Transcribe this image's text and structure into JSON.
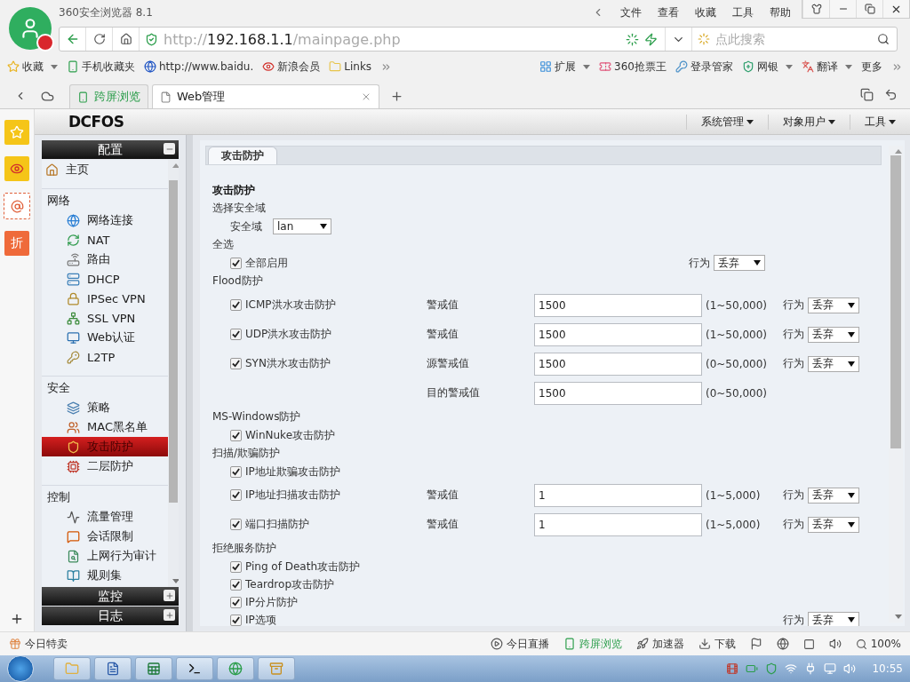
{
  "browser": {
    "title": "360安全浏览器 8.1",
    "menu": [
      "文件",
      "查看",
      "收藏",
      "工具",
      "帮助"
    ],
    "url": "http://**192.168.1.1**/mainpage.php",
    "search": {
      "placeholder": "点此搜索"
    }
  },
  "bookmarks": [
    {
      "label": "收藏",
      "dropdown": true
    },
    {
      "label": "手机收藏夹",
      "dropdown": false
    },
    {
      "label": "http://www.baidu.",
      "dropdown": false
    },
    {
      "label": "新浪会员",
      "dropdown": false
    },
    {
      "label": "Links",
      "dropdown": false
    }
  ],
  "extensions": [
    {
      "label": "扩展",
      "dropdown": true
    },
    {
      "label": "360抢票王",
      "dropdown": false
    },
    {
      "label": "登录管家",
      "dropdown": false
    },
    {
      "label": "网银",
      "dropdown": true
    },
    {
      "label": "翻译",
      "dropdown": true
    },
    {
      "label": "更多",
      "dropdown": false
    }
  ],
  "tabs": [
    {
      "label": "跨屏浏览",
      "selected": false
    },
    {
      "label": "Web管理",
      "selected": true
    }
  ],
  "rail": {
    "badge": "折"
  },
  "app": {
    "logo": "DCFOS",
    "menu": [
      "系统管理",
      "对象用户",
      "工具"
    ],
    "panels": [
      {
        "title": "配置",
        "expanded": true,
        "home": {
          "label": "主页",
          "selected": false
        },
        "groups": [
          {
            "title": "网络",
            "items": [
              {
                "label": "网络连接",
                "selected": false
              },
              {
                "label": "NAT",
                "selected": false
              },
              {
                "label": "路由",
                "selected": false
              },
              {
                "label": "DHCP",
                "selected": false
              },
              {
                "label": "IPSec VPN",
                "selected": false
              },
              {
                "label": "SSL VPN",
                "selected": false
              },
              {
                "label": "Web认证",
                "selected": false
              },
              {
                "label": "L2TP",
                "selected": false
              }
            ]
          },
          {
            "title": "安全",
            "items": [
              {
                "label": "策略",
                "selected": false
              },
              {
                "label": "MAC黑名单",
                "selected": false
              },
              {
                "label": "攻击防护",
                "selected": true
              },
              {
                "label": "二层防护",
                "selected": false
              }
            ]
          },
          {
            "title": "控制",
            "items": [
              {
                "label": "流量管理",
                "selected": false
              },
              {
                "label": "会话限制",
                "selected": false
              },
              {
                "label": "上网行为审计",
                "selected": false
              },
              {
                "label": "规则集",
                "selected": false
              }
            ]
          }
        ]
      },
      {
        "title": "监控",
        "expanded": false
      },
      {
        "title": "日志",
        "expanded": false
      }
    ],
    "tab": {
      "label": "攻击防护",
      "selected": true
    },
    "form": {
      "title": "攻击防护",
      "sections": [
        {
          "title": "选择安全域",
          "rows": [
            {
              "kind": "select",
              "label": "安全域",
              "value": "lan"
            }
          ]
        },
        {
          "title": "全选",
          "rows": [
            {
              "kind": "master",
              "label": "全部启用",
              "checked": true,
              "action_label": "行为",
              "action": "丢弃"
            }
          ]
        },
        {
          "title": "Flood防护",
          "rows": [
            {
              "kind": "check",
              "label": "ICMP洪水攻击防护",
              "checked": true,
              "threshold_label": "警戒值",
              "value": "1500",
              "range": "(1~50,000)",
              "action_label": "行为",
              "action": "丢弃"
            },
            {
              "kind": "check",
              "label": "UDP洪水攻击防护",
              "checked": true,
              "threshold_label": "警戒值",
              "value": "1500",
              "range": "(1~50,000)",
              "action_label": "行为",
              "action": "丢弃"
            },
            {
              "kind": "check",
              "label": "SYN洪水攻击防护",
              "checked": true,
              "threshold_label": "源警戒值",
              "value": "1500",
              "range": "(0~50,000)",
              "action_label": "行为",
              "action": "丢弃"
            },
            {
              "kind": "value",
              "threshold_label": "目的警戒值",
              "value": "1500",
              "range": "(0~50,000)"
            }
          ]
        },
        {
          "title": "MS-Windows防护",
          "rows": [
            {
              "kind": "check",
              "label": "WinNuke攻击防护",
              "checked": true
            }
          ]
        },
        {
          "title": "扫描/欺骗防护",
          "rows": [
            {
              "kind": "check",
              "label": "IP地址欺骗攻击防护",
              "checked": true
            },
            {
              "kind": "check",
              "label": "IP地址扫描攻击防护",
              "checked": true,
              "threshold_label": "警戒值",
              "value": "1",
              "range": "(1~5,000)",
              "action_label": "行为",
              "action": "丢弃"
            },
            {
              "kind": "check",
              "label": "端口扫描防护",
              "checked": true,
              "threshold_label": "警戒值",
              "value": "1",
              "range": "(1~5,000)",
              "action_label": "行为",
              "action": "丢弃"
            }
          ]
        },
        {
          "title": "拒绝服务防护",
          "rows": [
            {
              "kind": "check",
              "label": "Ping of Death攻击防护",
              "checked": true
            },
            {
              "kind": "check",
              "label": "Teardrop攻击防护",
              "checked": true
            },
            {
              "kind": "check",
              "label": "IP分片防护",
              "checked": true
            },
            {
              "kind": "check",
              "label": "IP选项",
              "checked": true,
              "action_label": "行为",
              "action": "丢弃"
            }
          ]
        }
      ]
    }
  },
  "status_bar": {
    "left": "今日特卖",
    "items": [
      {
        "label": "今日直播",
        "active": false
      },
      {
        "label": "跨屏浏览",
        "active": true
      },
      {
        "label": "加速器",
        "active": false
      },
      {
        "label": "下载",
        "active": false
      }
    ],
    "zoom": "100%"
  },
  "taskbar": {
    "time": "10:55"
  }
}
